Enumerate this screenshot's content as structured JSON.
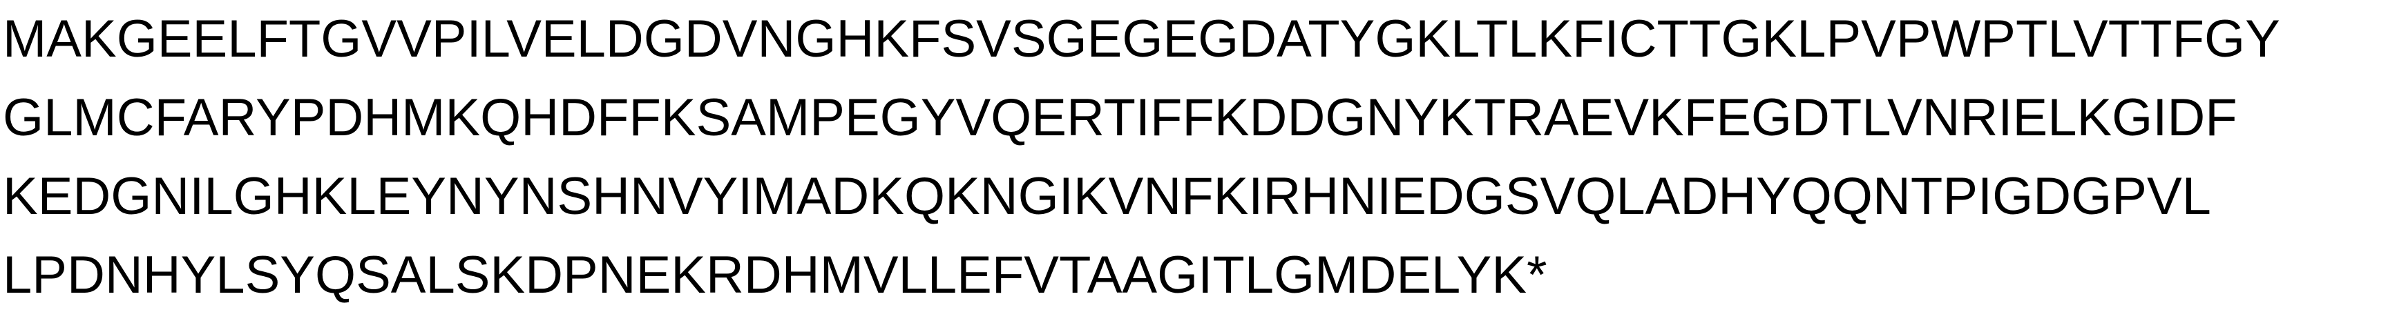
{
  "sequence_lines": [
    "MAKGEELFTGVVPILVELDGDVNGHKFSVSGEGEGDATYGKLTLKFICTTGKLPVPWPTLVTTFGY",
    "GLMCFARYPDHMKQHDFFKSAMPEGYVQERTIFFKDDGNYKTRAEVKFEGDTLVNRIELKGIDF",
    "KEDGNILGHKLEYNYNSHNVYIMADKQKNGIKVNFKIRHNIEDGSVQLADHYQQNTPIGDGPVL",
    "LPDNHYLSYQSALSKDPNEKRDHMVLLEFVTAAGITLGMDELYK*"
  ],
  "colors": {
    "text": "#000000",
    "background": "#ffffff"
  }
}
